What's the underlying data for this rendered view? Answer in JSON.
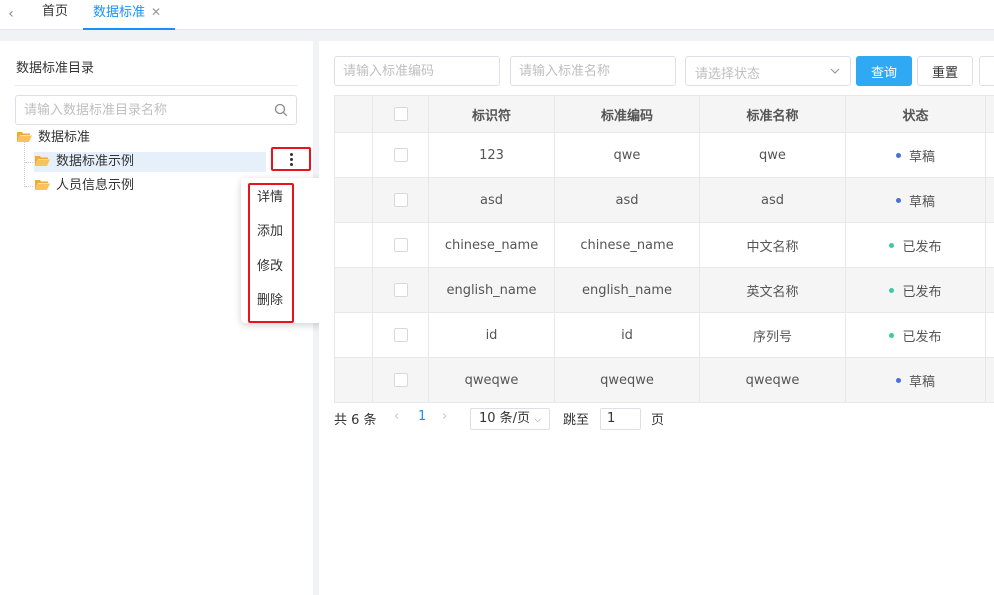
{
  "tabs": [
    {
      "label": "首页"
    },
    {
      "label": "数据标准",
      "active": true
    }
  ],
  "tree": {
    "title": "数据标准目录",
    "search_placeholder": "请输入数据标准目录名称",
    "root": "数据标准",
    "children": [
      "数据标准示例",
      "人员信息示例"
    ]
  },
  "context_menu": {
    "items": [
      "详情",
      "添加",
      "修改",
      "删除"
    ]
  },
  "filters": {
    "code_placeholder": "请输入标准编码",
    "name_placeholder": "请输入标准名称",
    "status_placeholder": "请选择状态",
    "query_label": "查询",
    "reset_label": "重置"
  },
  "table": {
    "headers": [
      "标识符",
      "标准编码",
      "标准名称",
      "状态"
    ],
    "rows": [
      {
        "identifier": "123",
        "code": "qwe",
        "name": "qwe",
        "status": "草稿"
      },
      {
        "identifier": "asd",
        "code": "asd",
        "name": "asd",
        "status": "草稿"
      },
      {
        "identifier": "chinese_name",
        "code": "chinese_name",
        "name": "中文名称",
        "status": "已发布"
      },
      {
        "identifier": "english_name",
        "code": "english_name",
        "name": "英文名称",
        "status": "已发布"
      },
      {
        "identifier": "id",
        "code": "id",
        "name": "序列号",
        "status": "已发布"
      },
      {
        "identifier": "qweqwe",
        "code": "qweqwe",
        "name": "qweqwe",
        "status": "草稿"
      }
    ]
  },
  "status_colors": {
    "draft": "#4a6fd8",
    "published": "#3ec99e"
  },
  "pagination": {
    "total": "共 6 条",
    "current": "1",
    "page_size": "10 条/页",
    "goto_label": "跳至",
    "goto_value": "1",
    "page_unit": "页"
  }
}
